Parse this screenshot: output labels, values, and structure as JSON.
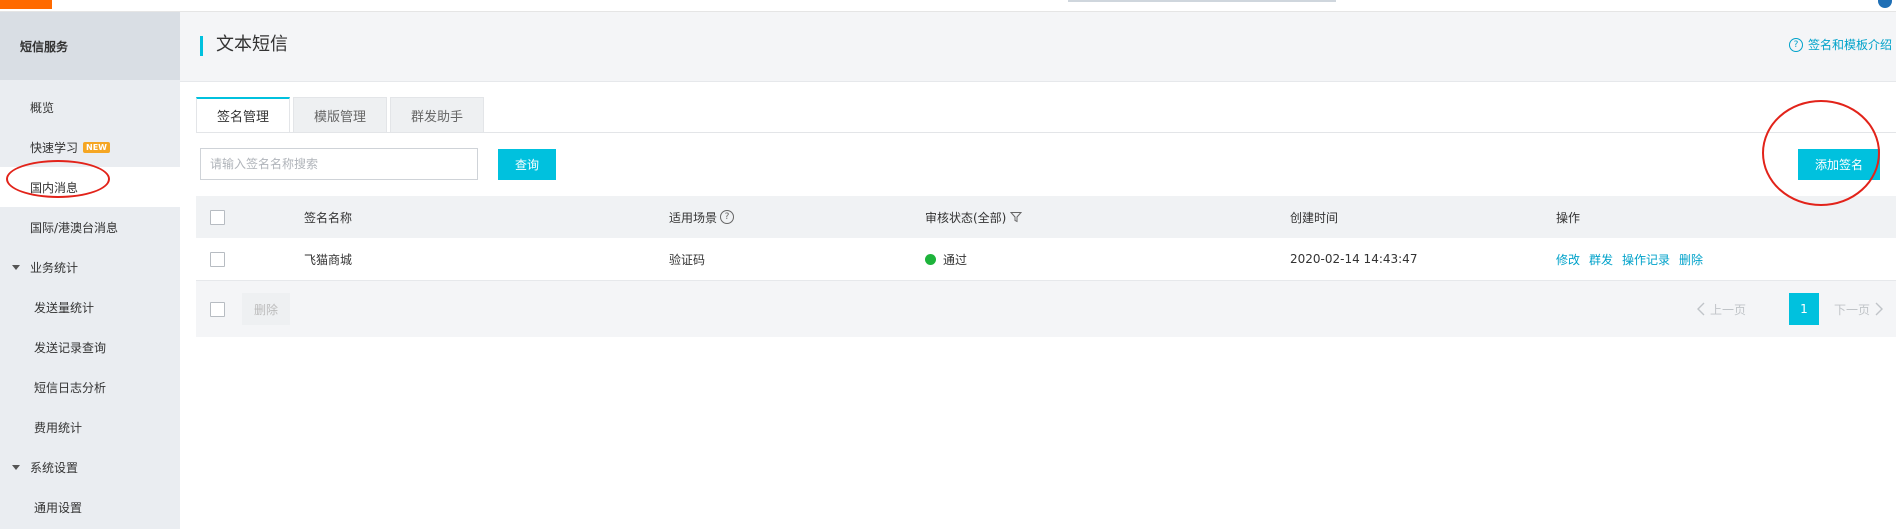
{
  "sidebar": {
    "title": "短信服务",
    "items": [
      {
        "label": "概览"
      },
      {
        "label": "快速学习",
        "badge": "NEW"
      },
      {
        "label": "国内消息"
      },
      {
        "label": "国际/港澳台消息"
      }
    ],
    "group_stats": "业务统计",
    "stats_items": [
      {
        "label": "发送量统计"
      },
      {
        "label": "发送记录查询"
      },
      {
        "label": "短信日志分析"
      },
      {
        "label": "费用统计"
      }
    ],
    "group_settings": "系统设置",
    "settings_items": [
      {
        "label": "通用设置"
      }
    ]
  },
  "header": {
    "title": "文本短信",
    "help_link": "签名和模板介绍"
  },
  "tabs": [
    {
      "label": "签名管理"
    },
    {
      "label": "模版管理"
    },
    {
      "label": "群发助手"
    }
  ],
  "search": {
    "placeholder": "请输入签名名称搜索",
    "query_label": "查询",
    "add_label": "添加签名"
  },
  "table": {
    "columns": {
      "name": "签名名称",
      "scene": "适用场景",
      "status": "审核状态(全部)",
      "created": "创建时间",
      "actions": "操作"
    },
    "rows": [
      {
        "name": "飞猫商城",
        "scene": "验证码",
        "status": "通过",
        "created": "2020-02-14 14:43:47",
        "actions": [
          "修改",
          "群发",
          "操作记录",
          "删除"
        ]
      }
    ]
  },
  "footer": {
    "delete_label": "删除",
    "prev_label": "上一页",
    "page": "1",
    "next_label": "下一页"
  },
  "colors": {
    "accent": "#00c1de",
    "link": "#00a2ca",
    "status_ok": "#1db33b",
    "annotation": "#e2231a",
    "brand": "#ff6a00"
  }
}
